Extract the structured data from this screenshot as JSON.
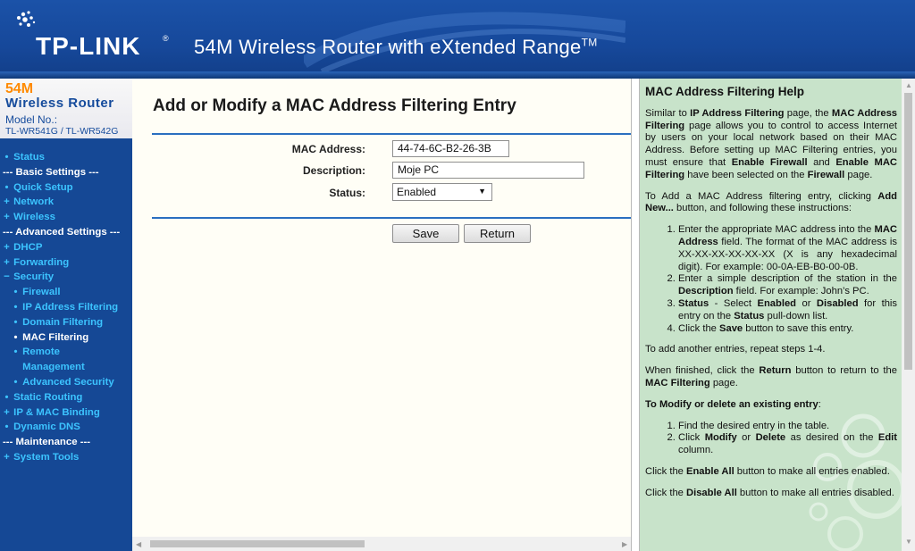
{
  "header": {
    "brand": "TP-LINK",
    "tm": "®",
    "product_title": "54M Wireless Router with eXtended Range",
    "product_tm": "TM"
  },
  "sidebar": {
    "brand_54m": "54M",
    "brand_wr": "Wireless Router",
    "model_label": "Model No.:",
    "model_value": "TL-WR541G / TL-WR542G",
    "items": [
      {
        "label": "Status",
        "bullet": "•",
        "level": 1
      },
      {
        "label": "--- Basic Settings ---",
        "bullet": "",
        "level": 0
      },
      {
        "label": "Quick Setup",
        "bullet": "•",
        "level": 1
      },
      {
        "label": "Network",
        "bullet": "+",
        "level": 1
      },
      {
        "label": "Wireless",
        "bullet": "+",
        "level": 1
      },
      {
        "label": "--- Advanced Settings ---",
        "bullet": "",
        "level": 0
      },
      {
        "label": "DHCP",
        "bullet": "+",
        "level": 1
      },
      {
        "label": "Forwarding",
        "bullet": "+",
        "level": 1
      },
      {
        "label": "Security",
        "bullet": "−",
        "level": 1
      },
      {
        "label": "Firewall",
        "bullet": "•",
        "level": 2
      },
      {
        "label": "IP Address Filtering",
        "bullet": "•",
        "level": 2
      },
      {
        "label": "Domain Filtering",
        "bullet": "•",
        "level": 2
      },
      {
        "label": "MAC Filtering",
        "bullet": "•",
        "level": 2,
        "active": true
      },
      {
        "label": "Remote Management",
        "bullet": "•",
        "level": 2
      },
      {
        "label": "Advanced Security",
        "bullet": "•",
        "level": 2
      },
      {
        "label": "Static Routing",
        "bullet": "•",
        "level": 1
      },
      {
        "label": "IP & MAC Binding",
        "bullet": "+",
        "level": 1
      },
      {
        "label": "Dynamic DNS",
        "bullet": "•",
        "level": 1
      },
      {
        "label": "--- Maintenance ---",
        "bullet": "",
        "level": 0
      },
      {
        "label": "System Tools",
        "bullet": "+",
        "level": 1
      }
    ]
  },
  "main": {
    "title": "Add or Modify a MAC Address Filtering Entry",
    "mac_label": "MAC Address:",
    "mac_value": "44-74-6C-B2-26-3B",
    "desc_label": "Description:",
    "desc_value": "Moje PC",
    "status_label": "Status:",
    "status_value": "Enabled",
    "save_label": "Save",
    "return_label": "Return"
  },
  "help": {
    "title": "MAC Address Filtering Help"
  },
  "colors": {
    "header_blue": "#16489a",
    "menu_link": "#3cc4ff",
    "help_bg": "#c8e3ca",
    "brand_orange": "#ff8a00"
  }
}
